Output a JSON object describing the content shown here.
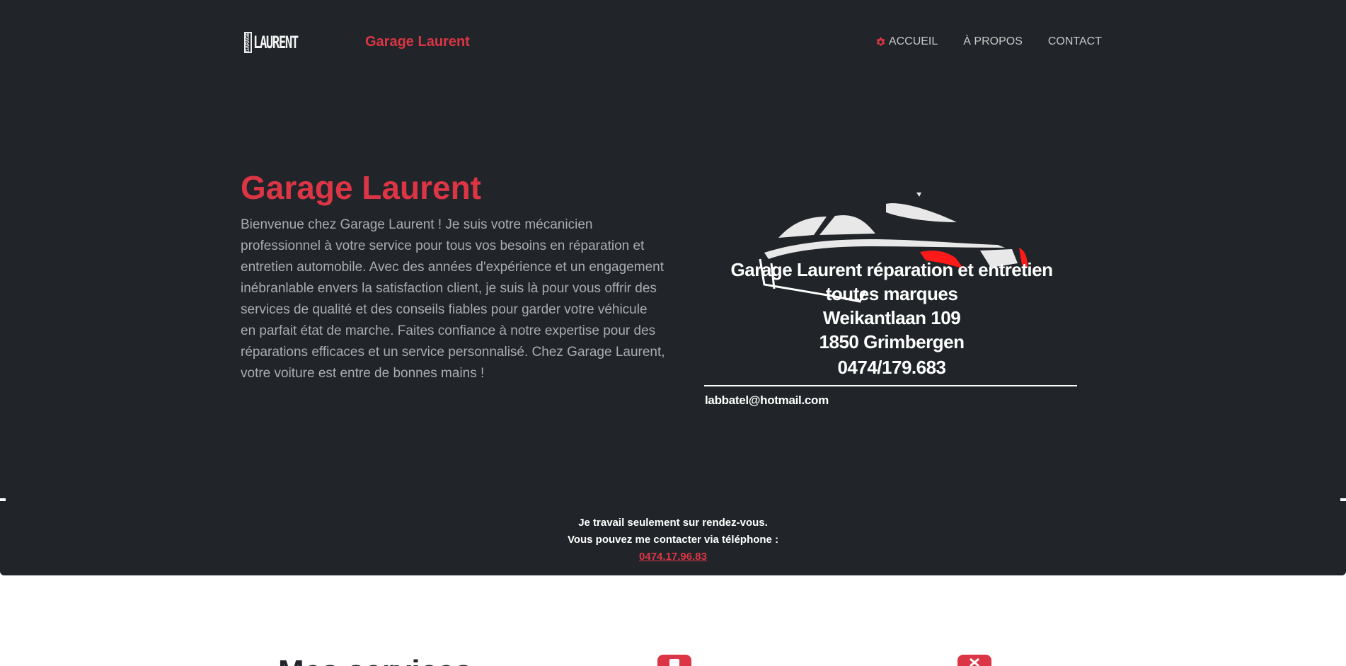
{
  "header": {
    "logo": {
      "side_text": "GARAGE",
      "word": "LAURENT"
    },
    "brand": "Garage Laurent",
    "nav": [
      {
        "label": "ACCUEIL",
        "icon": "gear-icon",
        "active": true
      },
      {
        "label": "À PROPOS"
      },
      {
        "label": "CONTACT"
      }
    ]
  },
  "hero": {
    "title": "Garage Laurent",
    "text": "Bienvenue chez Garage Laurent ! Je suis votre mécanicien professionnel à votre service pour tous vos besoins en réparation et entretien automobile. Avec des années d'expérience et un engagement inébranlable envers la satisfaction client, je suis là pour vous offrir des services de qualité et des conseils fiables pour garder votre véhicule en parfait état de marche. Faites confiance à notre expertise pour des réparations efficaces et un service personnalisé. Chez Garage Laurent, votre voiture est entre de bonnes mains !",
    "card": {
      "lines": [
        "Garage Laurent réparation et entretien",
        "toutes marques",
        "Weikantlaan  109",
        "1850 Grimbergen",
        "0474/179.683"
      ],
      "email": "labbatel@hotmail.com"
    }
  },
  "notice": {
    "line1": "Je travail seulement sur rendez-vous.",
    "line2": "Vous pouvez me contacter via téléphone :",
    "phone": "0474.17.96.83"
  },
  "below": {
    "section_title": "Mes services"
  },
  "colors": {
    "accent": "#dc3545",
    "dark": "#212529",
    "muted_text": "#a9adb1"
  }
}
